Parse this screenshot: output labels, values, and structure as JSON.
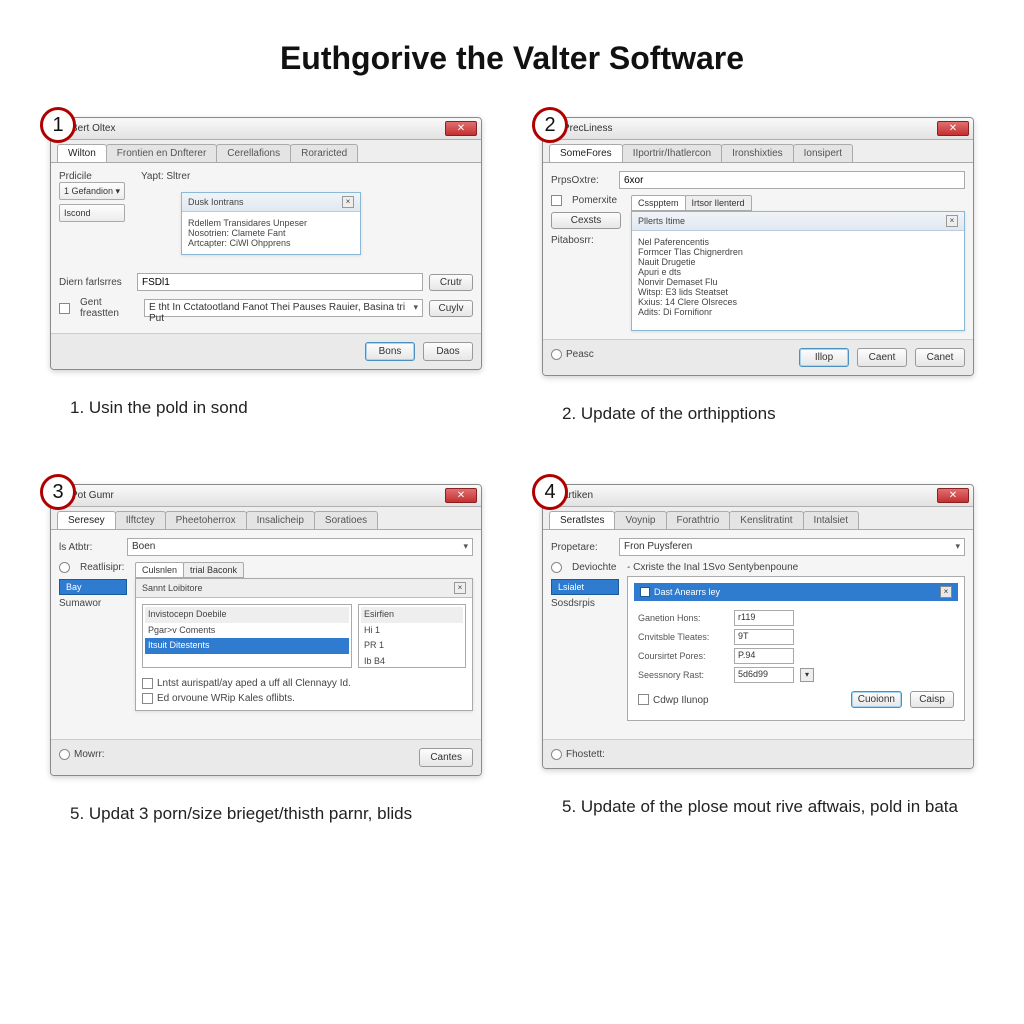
{
  "page_title": "Euthgorive the Valter Software",
  "step1": {
    "badge": "1",
    "caption": "1. Usin the pold in sond",
    "window_title": "Bert Oltex",
    "tabs": [
      "Wilton",
      "Frontien en Dnfterer",
      "Cerellafions",
      "Roraricted"
    ],
    "sidebar_label": "Prdicile",
    "sidebar_items": [
      "1 Gefandion",
      "Iscond"
    ],
    "sub_header": "Yapt: Sltrer",
    "panel_header": "Dusk Iontrans",
    "panel_lines": [
      "Rdellem Transidares Unpeser",
      "Nosotrien: Clamete Fant",
      "Artcapter: CiWl Ohpprens"
    ],
    "field1_label": "Diern farlsrres",
    "field1_value": "FSDl1",
    "btn_create": "Crutr",
    "check_label": "Gent freastten",
    "combo_value": "E tht In Cctatootland Fanot Thei Pauses Rauier, Basina tri Put",
    "btn_cuylv": "Cuylv",
    "btn_bons": "Bons",
    "btn_daos": "Daos"
  },
  "step2": {
    "badge": "2",
    "caption": "2. Update of the orthipptions",
    "window_title": "PrecLiness",
    "tabs": [
      "SomeFores",
      "IIportrir/Ihatlercon",
      "Ironshixties",
      "Ionsipert"
    ],
    "row1_label": "PrpsOxtre:",
    "row1_value": "6xor",
    "small_tabs": [
      "Csspptem",
      "Irtsor Ilenterd"
    ],
    "sidebar_btn": "Cexsts",
    "sidebar_label": "Pitabosrr:",
    "sidebar_check": "Pomerxite",
    "panel_header": "Pllerts Itime",
    "panel_lines": [
      "Nel Paferencentis",
      "Formcer Tlas Chignerdren",
      "Nauit Drugetie",
      "Apuri e dts",
      "Nonvir Demaset Flu",
      "Witsp: E3 lids Steatset",
      "Kxius: 14 Clere Olsreces",
      "Adits: Di Fornifionr"
    ],
    "radio_label": "Peasc",
    "btn_illop": "Illop",
    "btn_caent": "Caent",
    "btn_canet": "Canet"
  },
  "step3": {
    "badge": "3",
    "caption": "5. Updat 3 porn/size brieget/thisth parnr, blids",
    "window_title": "Pot Gumr",
    "tabs": [
      "Seresey",
      "Ilftctey",
      "Pheetoherrox",
      "Insalicheip",
      "Soratioes"
    ],
    "row1_label": "ls Atbtr:",
    "row1_value": "Boen",
    "row2_label": "Reatlisipr:",
    "small_tabs": [
      "Culsnlen",
      "trial Baconk"
    ],
    "sidebar_items": [
      "Bay",
      "Sumawor"
    ],
    "panel_header": "Sannt Loibitore",
    "col1_header": "Invistocepn Doebile",
    "col2_header": "Esirfien",
    "list_items": [
      "Pgar>v Coments",
      "Itsuit Ditestents"
    ],
    "col2_vals": [
      "Hi 1",
      "PR 1",
      "Ib B4"
    ],
    "check1": "Lntst aurispatl/ay aped a uff all Clennayy Id.",
    "check2": "Ed orvoune WRip Kales oflibts.",
    "radio_label": "Mowrr:",
    "btn_cantes": "Cantes"
  },
  "step4": {
    "badge": "4",
    "caption": "5. Update of the plose mout rive aftwais, pold in bata",
    "window_title": "artiken",
    "tabs": [
      "Seratlstes",
      "Voynip",
      "Forathtrio",
      "Kenslitratint",
      "Intalsiet"
    ],
    "row1_label": "Propetare:",
    "row1_value": "Fron Puysferen",
    "row2_top": "- Cxriste the Inal 1Svo Sentybenpoune",
    "sidebar_items": [
      "Deviochte",
      "Lsialet",
      "Sosdsrpis"
    ],
    "header_text": "Dast Anearrs ley",
    "props": [
      {
        "label": "Ganetion Hons:",
        "val": "r119"
      },
      "Cnvitsble Tleates:",
      "Coursirtet Pores:",
      "Seessnory Rast:"
    ],
    "vals": [
      "r119",
      "9T",
      "P.94",
      "5d6d99"
    ],
    "check_label": "Cdwp Ilunop",
    "btn_custom": "Cuoionn",
    "btn_caisp": "Caisp",
    "radio_label": "Fhostett:"
  }
}
